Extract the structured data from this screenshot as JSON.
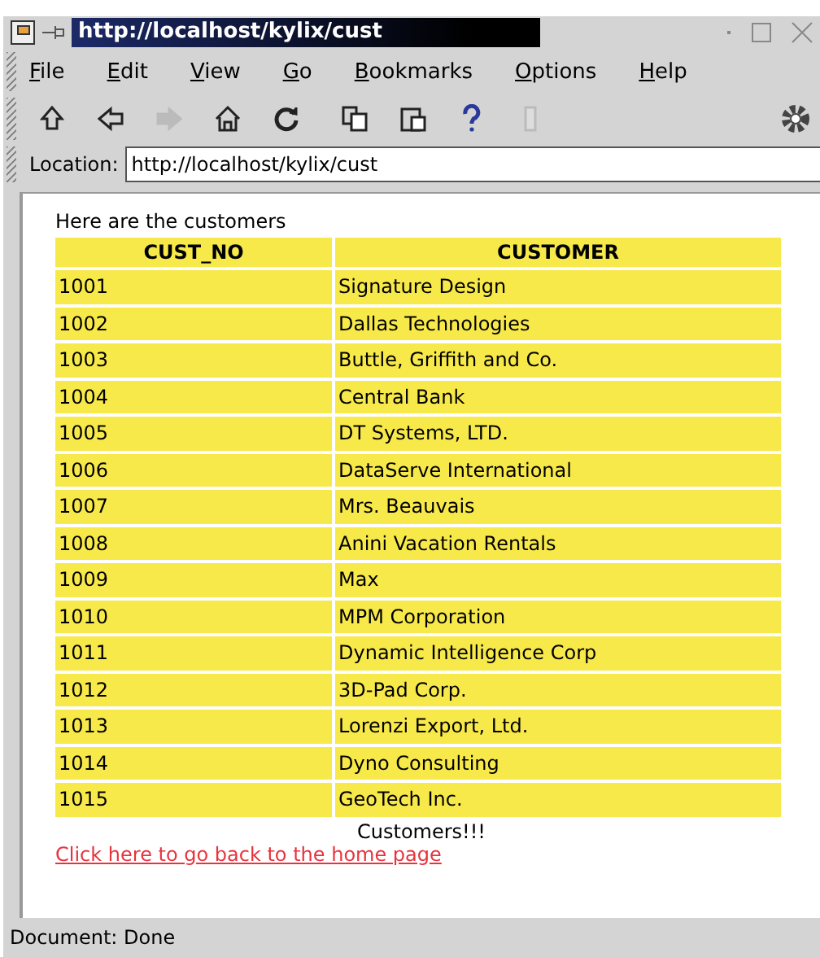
{
  "window": {
    "title": "http://localhost/kylix/cust"
  },
  "menu": [
    "File",
    "Edit",
    "View",
    "Go",
    "Bookmarks",
    "Options",
    "Help"
  ],
  "toolbar": [
    {
      "kind": "up",
      "disabled": false
    },
    {
      "kind": "back",
      "disabled": false
    },
    {
      "kind": "forward",
      "disabled": true
    },
    {
      "kind": "home",
      "disabled": false
    },
    {
      "kind": "reload",
      "disabled": false
    },
    {
      "kind": "copy",
      "disabled": false
    },
    {
      "kind": "paste",
      "disabled": false
    },
    {
      "kind": "help",
      "disabled": false
    },
    {
      "kind": "stop",
      "disabled": true
    }
  ],
  "location": {
    "label": "Location:",
    "value": "http://localhost/kylix/cust"
  },
  "page": {
    "intro": "Here are the customers",
    "table": {
      "columns": [
        "CUST_NO",
        "CUSTOMER"
      ],
      "rows": [
        [
          "1001",
          "Signature Design"
        ],
        [
          "1002",
          "Dallas Technologies"
        ],
        [
          "1003",
          "Buttle, Griffith and Co."
        ],
        [
          "1004",
          "Central Bank"
        ],
        [
          "1005",
          "DT Systems, LTD."
        ],
        [
          "1006",
          "DataServe International"
        ],
        [
          "1007",
          "Mrs. Beauvais"
        ],
        [
          "1008",
          "Anini Vacation Rentals"
        ],
        [
          "1009",
          "Max"
        ],
        [
          "1010",
          "MPM Corporation"
        ],
        [
          "1011",
          "Dynamic Intelligence Corp"
        ],
        [
          "1012",
          "3D-Pad Corp."
        ],
        [
          "1013",
          "Lorenzi Export, Ltd."
        ],
        [
          "1014",
          "Dyno Consulting"
        ],
        [
          "1015",
          "GeoTech Inc."
        ]
      ],
      "caption": "Customers!!!"
    },
    "link": "Click here to go back to the home page"
  },
  "status_bar": "Document: Done"
}
